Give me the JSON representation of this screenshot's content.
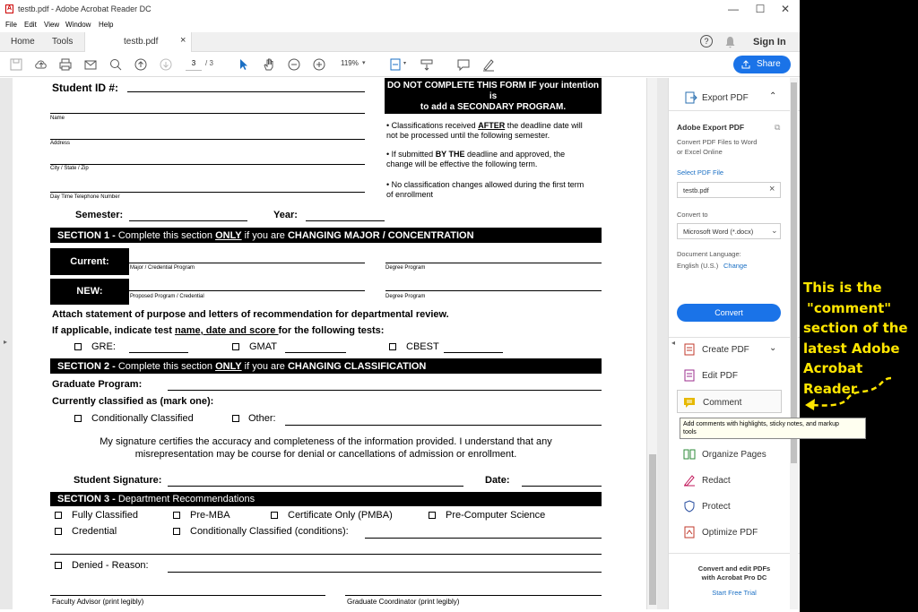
{
  "window": {
    "title": "testb.pdf - Adobe Acrobat Reader DC",
    "app_icon": "acrobat-icon",
    "controls": [
      "minimize-icon",
      "maximize-icon",
      "close-icon"
    ],
    "minimize_glyph": "—",
    "maximize_glyph": "☐",
    "close_glyph": "✕"
  },
  "menu": {
    "items": [
      "File",
      "Edit",
      "View",
      "Window",
      "Help"
    ]
  },
  "tabs": {
    "home": "Home",
    "tools": "Tools",
    "document": "testb.pdf",
    "close_glyph": "×",
    "sign_in": "Sign In"
  },
  "toolbar": {
    "page_current": "3",
    "page_total": "/ 3",
    "zoom": "119%",
    "zoom_caret": "▾",
    "share": "Share",
    "icons": [
      "save-icon",
      "upload-icon",
      "print-icon",
      "email-icon",
      "search-icon",
      "page-up-icon",
      "page-down-icon",
      "select-cursor-icon",
      "hand-icon",
      "zoom-out-icon",
      "zoom-in-icon",
      "fit-page-icon",
      "scroll-mode-icon",
      "comment-icon",
      "sign-icon",
      "help-icon",
      "bell-icon"
    ]
  },
  "form": {
    "student_id": "Student ID #:",
    "warning_line1": "DO NOT COMPLETE THIS FORM IF your intention is",
    "warning_line2": "to add a SECONDARY PROGRAM.",
    "name": "Name",
    "address": "Address",
    "city": "City / State / Zip",
    "phone": "Day Time Telephone Number",
    "bullet1a": "• Classifications received ",
    "bullet1b": "AFTER",
    "bullet1c": " the deadline date will",
    "bullet1d": "not be processed until the following semester.",
    "bullet2a": "• If submitted ",
    "bullet2b": "BY THE",
    "bullet2c": " deadline and approved, the",
    "bullet2d": "change will be effective the following term.",
    "bullet3a": "• No classification changes allowed during the first term",
    "bullet3b": "of enrollment",
    "semester": "Semester:",
    "year": "Year:",
    "section1a": "SECTION 1 - ",
    "section1b": "Complete this section ",
    "section1c": "ONLY",
    "section1d": " if you are ",
    "section1e": "CHANGING MAJOR / CONCENTRATION",
    "current": "Current:",
    "new": "NEW:",
    "major_program": "Major / Credential Program",
    "degree_program": "Degree Program",
    "proposed_program": "Proposed Program / Credential",
    "degree_program2": "Degree Program",
    "attach": "Attach statement of purpose and letters of recommendation for departmental review.",
    "applicable_a": "If applicable, indicate test ",
    "applicable_b": "name, date and score ",
    "applicable_c": "for the following tests:",
    "gre": "GRE:",
    "gmat": "GMAT",
    "cbest": "CBEST",
    "section2a": "SECTION 2 - ",
    "section2b": "Complete this section ",
    "section2c": "ONLY",
    "section2d": " if you are ",
    "section2e": "CHANGING CLASSIFICATION",
    "graduate_program": "Graduate Program:",
    "currently_classified": "Currently classified as (mark one):",
    "conditionally_classified": "Conditionally Classified",
    "other": "Other:",
    "certify1": "My signature certifies the accuracy and completeness of the information provided.  I understand that any",
    "certify2": "misrepresentation may be course for denial or cancellations of admission or enrollment.",
    "student_signature": "Student Signature:",
    "date": "Date:",
    "section3a": "SECTION 3 - ",
    "section3b": "Department Recommendations",
    "fully_classified": "Fully Classified",
    "pre_mba": "Pre-MBA",
    "certificate_only": "Certificate Only (PMBA)",
    "pre_cs": "Pre-Computer Science",
    "credential": "Credential",
    "cond_classified_cond": "Conditionally Classified (conditions):",
    "denied": "Denied - Reason:",
    "faculty_advisor": "Faculty Advisor (print legibly)",
    "grad_coordinator": "Graduate Coordinator (print legibly)"
  },
  "right_panel": {
    "export_pdf": "Export PDF",
    "adobe_export_pdf": "Adobe Export PDF",
    "convert_desc1": "Convert PDF Files to Word",
    "convert_desc2": "or Excel Online",
    "select_pdf_file": "Select PDF File",
    "file_value": "testb.pdf",
    "convert_to": "Convert to",
    "convert_format": "Microsoft Word (*.docx)",
    "doc_language": "Document Language:",
    "language": "English (U.S.)",
    "change": "Change",
    "convert_button": "Convert",
    "create_pdf": "Create PDF",
    "edit_pdf": "Edit PDF",
    "comment": "Comment",
    "organize_pages": "Organize Pages",
    "redact": "Redact",
    "protect": "Protect",
    "optimize_pdf": "Optimize PDF",
    "promo1": "Convert and edit PDFs",
    "promo2": "with Acrobat Pro DC",
    "start_free_trial": "Start Free Trial",
    "colors": {
      "export": "#2a6fb0",
      "create": "#c0392b",
      "edit": "#9b2d8e",
      "comment": "#e6b800",
      "organize": "#2e8b3a",
      "redact": "#c2185b",
      "protect": "#2a4fa0",
      "optimize": "#c0392b",
      "link": "#1a6fc4"
    }
  },
  "tooltip": {
    "line1": "Add comments with highlights, sticky notes, and markup",
    "line2": "tools"
  },
  "annotation": {
    "line1": "This is the",
    "line2": "\"comment\"",
    "line3": "section of the",
    "line4": "latest Adobe",
    "line5": "Acrobat Reader",
    "color": "#ffe600"
  }
}
